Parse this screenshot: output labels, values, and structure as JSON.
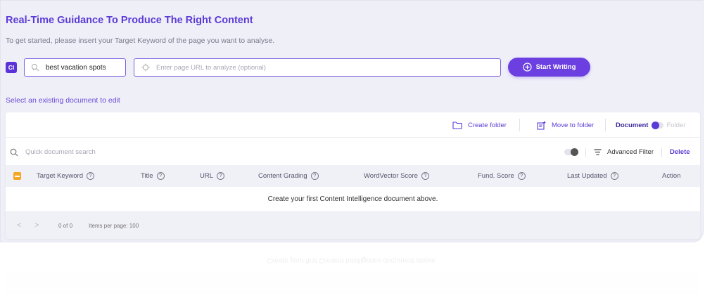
{
  "header": {
    "title": "Real-Time Guidance To Produce The Right Content",
    "subtitle": "To get started, please insert your Target Keyword of the page you want to analyse."
  },
  "form": {
    "badge": "CI",
    "keyword_value": "best vacation spots",
    "url_placeholder": "Enter page URL to analyze (optional)",
    "start_label": "Start Writing"
  },
  "select_existing": "Select an existing document to edit",
  "toolbar": {
    "create_folder": "Create folder",
    "move_to_folder": "Move to folder",
    "document_label": "Document",
    "folder_label": "Folder"
  },
  "search": {
    "placeholder": "Quick document search",
    "advanced_filter": "Advanced Filter",
    "delete": "Delete"
  },
  "table": {
    "columns": [
      "Target Keyword",
      "Title",
      "URL",
      "Content Grading",
      "WordVector Score",
      "Fund. Score",
      "Last Updated",
      "Action"
    ],
    "help_glyph": "?",
    "empty_message": "Create your first Content Intelligence document above."
  },
  "pagination": {
    "prev": "<",
    "next": ">",
    "range": "0 of 0",
    "items_per_page": "Items per page: 100"
  },
  "colors": {
    "brand": "#5b3bd6",
    "button": "#6b3fe0",
    "checkbox": "#f5a623"
  }
}
